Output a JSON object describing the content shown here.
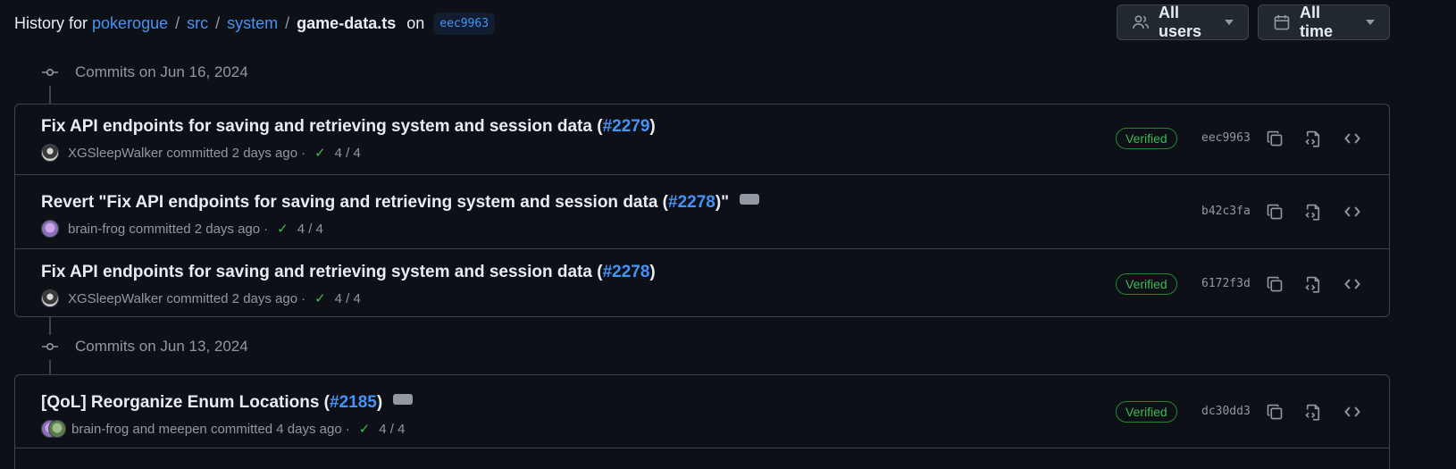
{
  "header": {
    "prefix": "History for",
    "repo": "pokerogue",
    "path1": "src",
    "path2": "system",
    "file": "game-data.ts",
    "on": "on",
    "ref": "eec9963"
  },
  "filters": {
    "users": "All users",
    "time": "All time"
  },
  "groups": [
    {
      "date": "Commits on Jun 16, 2024",
      "commits": [
        {
          "title": "Fix API endpoints for saving and retrieving system and session data (",
          "pr": "#2279",
          "title_end": ")",
          "author": "XGSleepWalker",
          "action": "committed 2 days ago",
          "dot": "·",
          "checks": "4 / 4",
          "verified": "Verified",
          "sha": "eec9963"
        },
        {
          "title": "Revert \"Fix API endpoints for saving and retrieving system and session data (",
          "pr": "#2278",
          "title_end": ")\"",
          "author": "brain-frog",
          "action": "committed 2 days ago",
          "dot": "·",
          "checks": "4 / 4",
          "verified": "",
          "sha": "b42c3fa"
        },
        {
          "title": "Fix API endpoints for saving and retrieving system and session data (",
          "pr": "#2278",
          "title_end": ")",
          "author": "XGSleepWalker",
          "action": "committed 2 days ago",
          "dot": "·",
          "checks": "4 / 4",
          "verified": "Verified",
          "sha": "6172f3d"
        }
      ]
    },
    {
      "date": "Commits on Jun 13, 2024",
      "commits": [
        {
          "title": "[QoL] Reorganize Enum Locations (",
          "pr": "#2185",
          "title_end": ")",
          "author": "brain-frog and meepen",
          "action": "committed 4 days ago",
          "dot": "·",
          "checks": "4 / 4",
          "verified": "Verified",
          "sha": "dc30dd3"
        }
      ]
    }
  ],
  "colors": {
    "accent": "#4493f8",
    "success": "#3fb950",
    "background": "#0d1117",
    "border": "#3d444d"
  },
  "icons": [
    "people-icon",
    "calendar-icon",
    "commit-icon",
    "check-icon",
    "copy-icon",
    "file-code-icon",
    "code-icon",
    "ellipsis-icon"
  ]
}
